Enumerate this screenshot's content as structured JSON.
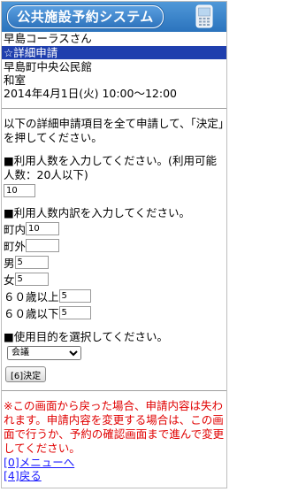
{
  "header": {
    "title": "公共施設予約システム",
    "icon": "mobile-phone-icon"
  },
  "user": {
    "greeting": "早島コーラスさん"
  },
  "section": {
    "title": "☆詳細申請"
  },
  "facility": {
    "name": "早島町中央公民館",
    "room": "和室",
    "datetime": "2014年4月1日(火) 10:00～12:00"
  },
  "instruction": "以下の詳細申請項目を全て申請して、「決定」を押してください。",
  "count": {
    "label": "■利用人数を入力してください。(利用可能人数：20人以下)",
    "value": "10"
  },
  "breakdown": {
    "label": "■利用人数内訳を入力してください。",
    "rows": [
      {
        "label": "町内",
        "value": "10"
      },
      {
        "label": "町外",
        "value": ""
      },
      {
        "label": "男",
        "value": "5"
      },
      {
        "label": "女",
        "value": "5"
      },
      {
        "label": "６０歳以上",
        "value": "5"
      },
      {
        "label": "６０歳以下",
        "value": "5"
      }
    ]
  },
  "purpose": {
    "label": "■使用目的を選択してください。",
    "selected": "会議"
  },
  "submit": {
    "label": "[6]決定"
  },
  "warning": "※この画面から戻った場合、申請内容は失われます。申請内容を変更する場合は、この画面で行うか、予約の確認画面まで進んで変更してください。",
  "links": {
    "menu": "[0]メニューへ",
    "back": "[4]戻る"
  },
  "colors": {
    "header": "#2b73bd",
    "section_bar": "#1f3fae",
    "warning": "#e00000",
    "link": "#1a1aff"
  }
}
